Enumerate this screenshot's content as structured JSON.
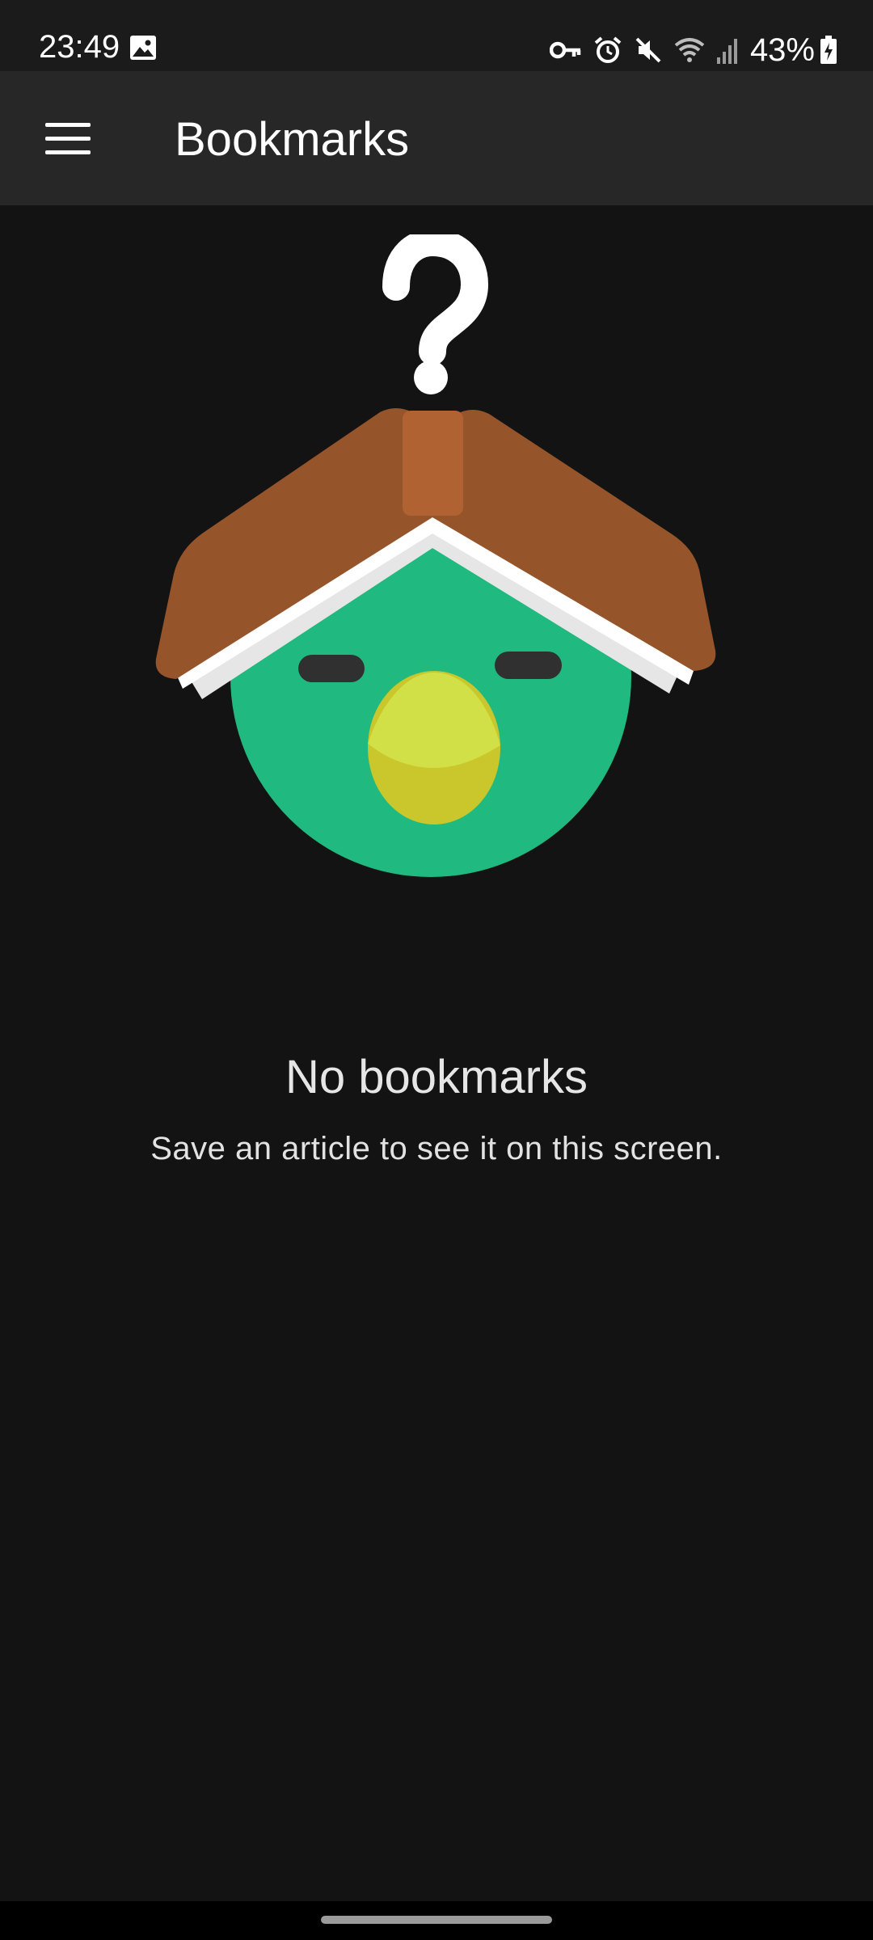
{
  "status_bar": {
    "time": "23:49",
    "battery_percent": "43%",
    "icons": [
      "gallery-icon",
      "vpn-key-icon",
      "alarm-icon",
      "mute-icon",
      "wifi-icon",
      "cell-signal-icon",
      "battery-charging-icon"
    ]
  },
  "app_bar": {
    "title": "Bookmarks",
    "menu_icon": "menu-icon"
  },
  "empty_state": {
    "title": "No bookmarks",
    "subtitle": "Save an article to see it on this screen."
  },
  "colors": {
    "background": "#131313",
    "app_bar": "#272727",
    "status_bar": "#1b1b1b",
    "book_cover": "#96542a",
    "book_spine": "#b06233",
    "bird_body": "#20b97f",
    "bird_beak": "#d1e046",
    "bird_eyes": "#303030"
  }
}
